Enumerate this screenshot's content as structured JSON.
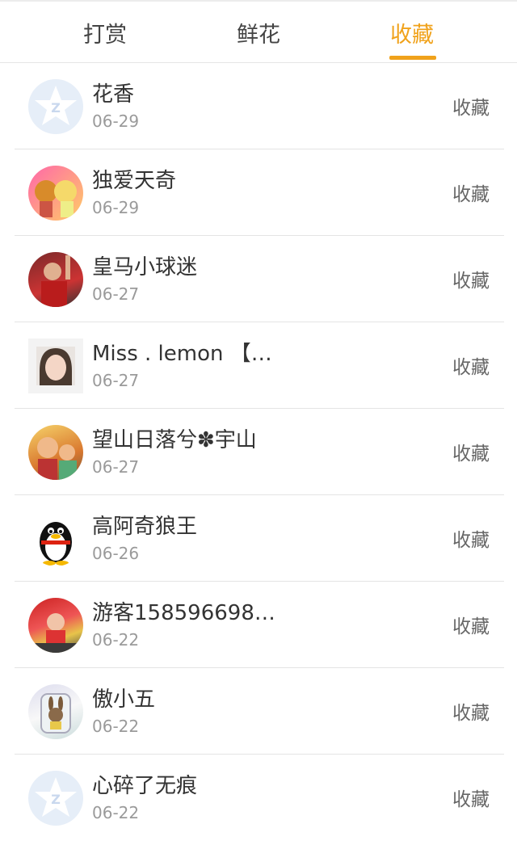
{
  "tabs": [
    {
      "label": "打赏",
      "active": false
    },
    {
      "label": "鲜花",
      "active": false
    },
    {
      "label": "收藏",
      "active": true
    }
  ],
  "accent_color": "#f0a21b",
  "items": [
    {
      "name": "花香",
      "date": "06-29",
      "action": "收藏",
      "avatar": "qzone-star-avatar"
    },
    {
      "name": "独爱天奇",
      "date": "06-29",
      "action": "收藏",
      "avatar": "cartoon-kiss-avatar"
    },
    {
      "name": "皇马小球迷",
      "date": "06-27",
      "action": "收藏",
      "avatar": "soccer-player-avatar"
    },
    {
      "name": "Miss . lemon 【…",
      "date": "06-27",
      "action": "收藏",
      "avatar": "girl-photo-avatar"
    },
    {
      "name": "望山日落兮✽宇山",
      "date": "06-27",
      "action": "收藏",
      "avatar": "cartoon-family-avatar"
    },
    {
      "name": "高阿奇狼王",
      "date": "06-26",
      "action": "收藏",
      "avatar": "qq-penguin-avatar"
    },
    {
      "name": "游客158596698…",
      "date": "06-22",
      "action": "收藏",
      "avatar": "child-photo-avatar"
    },
    {
      "name": "傲小五",
      "date": "06-22",
      "action": "收藏",
      "avatar": "rabbit-jar-avatar"
    },
    {
      "name": "心碎了无痕",
      "date": "06-22",
      "action": "收藏",
      "avatar": "qzone-star-avatar"
    }
  ]
}
